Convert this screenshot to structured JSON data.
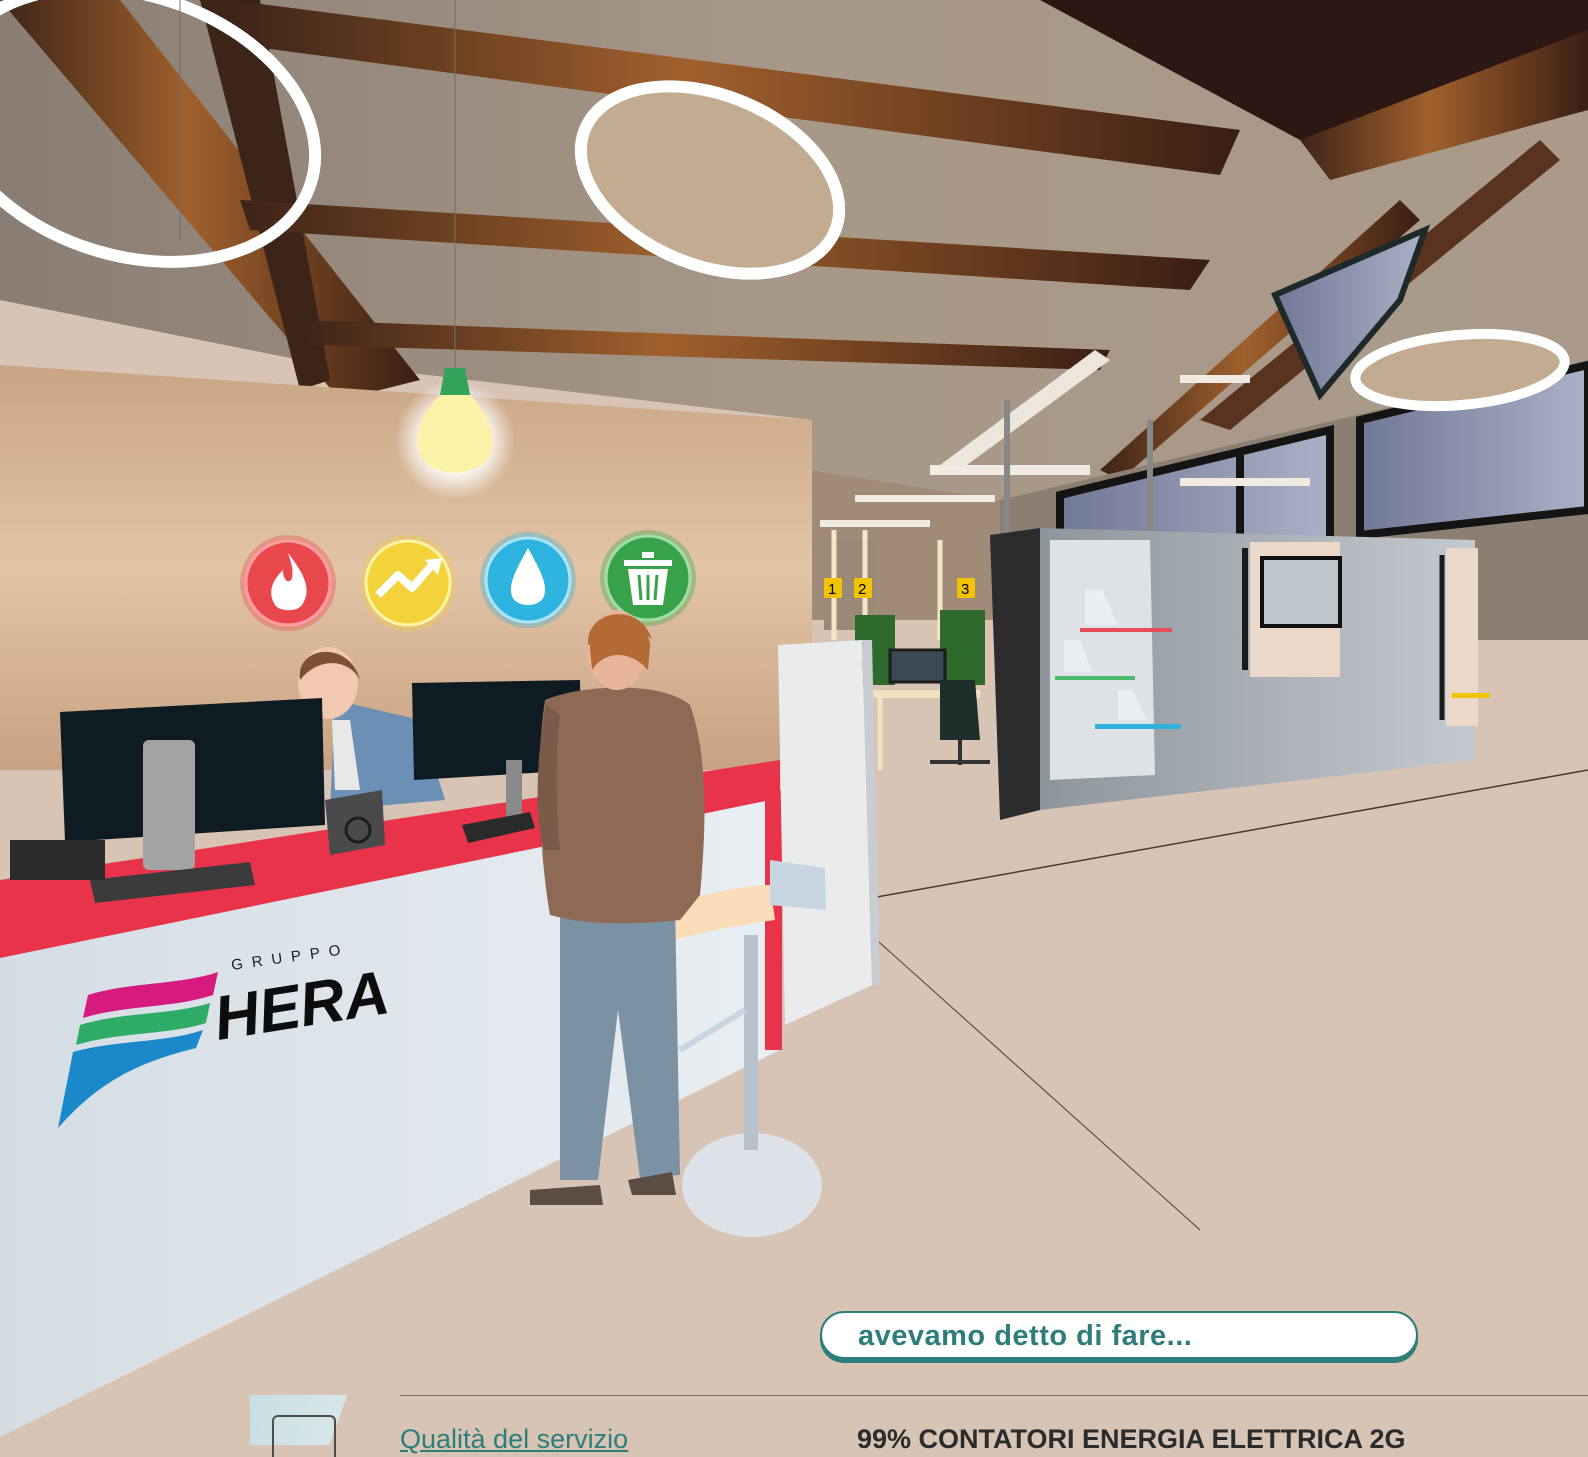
{
  "brand": {
    "group": "GRUPPO",
    "name": "HERA",
    "stripe_colors": [
      "#d61a7f",
      "#2eac66",
      "#1b88c9"
    ]
  },
  "service_icons": [
    {
      "name": "flame-icon",
      "color": "#e8474b"
    },
    {
      "name": "energy-icon",
      "color": "#f4d23b"
    },
    {
      "name": "water-drop-icon",
      "color": "#2fb3df"
    },
    {
      "name": "trash-bin-icon",
      "color": "#37a24a"
    }
  ],
  "counter_numbers": [
    "1",
    "2",
    "3"
  ],
  "callout": {
    "text": "avevamo detto di fare..."
  },
  "footer": {
    "left_label": "Qualità del servizio",
    "right_label": "99% CONTATORI ENERGIA ELETTRICA 2G"
  },
  "colors": {
    "accent_teal": "#2d7d7a",
    "counter_red": "#e8334a",
    "floor": "#d7c4b5"
  }
}
